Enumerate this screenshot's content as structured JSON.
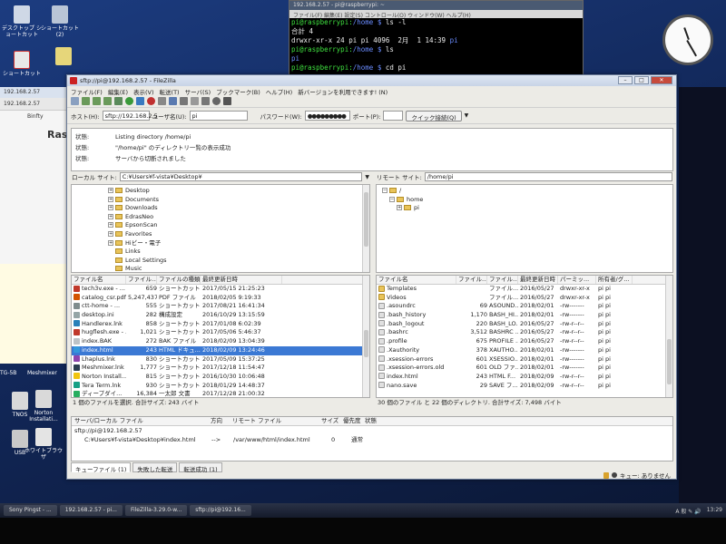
{
  "desktop_icons": [
    {
      "label": "デスクトップ\nショートカット"
    },
    {
      "label": "ショートカット\n(2)"
    },
    {
      "label": "ショートカット"
    },
    {
      "label": "TNOS"
    },
    {
      "label": "Norton\nInstallati..."
    },
    {
      "label": "USB"
    },
    {
      "label": "ホワイトブラウザ"
    }
  ],
  "bg_window": {
    "title": "192.168.2.57",
    "tab": "192.168.2.57",
    "heading": "Rasp",
    "bookmark": "Binfty",
    "side_labels": [
      "TG-5B",
      "Meshmixer"
    ]
  },
  "terminal": {
    "title": "192.168.2.57 - pi@raspberrypi: ~",
    "menu": "ファイル(F)  編集(E)  設定(S)  コントロール(O)  ウィンドウ(W)  ヘルプ(H)",
    "lines": [
      {
        "prompt": "pi@raspberrypi:",
        "path": "/home $",
        "cmd": " ls -l"
      },
      {
        "text": "合計 4"
      },
      {
        "text": "drwxr-xr-x 24 pi pi 4096  2月  1 14:39 ",
        "blue": "pi"
      },
      {
        "prompt": "pi@raspberrypi:",
        "path": "/home $",
        "cmd": " ls"
      },
      {
        "blue": "pi"
      },
      {
        "prompt": "pi@raspberrypi:",
        "path": "/home $",
        "cmd": " cd pi"
      }
    ]
  },
  "filezilla": {
    "title": "sftp://pi@192.168.2.57 - FileZilla",
    "menu": [
      "ファイル(F)",
      "編集(E)",
      "表示(V)",
      "転送(T)",
      "サーバ(S)",
      "ブックマーク(B)",
      "ヘルプ(H)",
      "新バージョンを利用できます! (N)"
    ],
    "quickconnect": {
      "host_label": "ホスト(H):",
      "host_value": "sftp://192.168.2.5",
      "user_label": "ユーザ名(U):",
      "user_value": "pi",
      "pass_label": "パスワード(W):",
      "pass_value": "●●●●●●●●●",
      "port_label": "ポート(P):",
      "port_value": "",
      "button": "クイック接続(Q)"
    },
    "log": [
      {
        "k": "状態:",
        "v": "Listing directory /home/pi"
      },
      {
        "k": "状態:",
        "v": "\"/home/pi\" のディレクトリ一覧の表示成功"
      },
      {
        "k": "状態:",
        "v": "サーバから切断されました"
      }
    ],
    "local": {
      "site_label": "ローカル サイト:",
      "path": "C:¥Users¥f-vista¥Desktop¥",
      "tree": [
        "Desktop",
        "Documents",
        "Downloads",
        "EdrasNeo",
        "EpsonScan",
        "Favorites",
        "Hiビー・電子",
        "Links",
        "Local Settings",
        "Music"
      ],
      "columns": [
        "ファイル名",
        "ファイル...",
        "ファイルの種類",
        "最終更新日時"
      ],
      "files": [
        {
          "name": "tech3v.exe - ...",
          "size": "659",
          "type": "ショートカット",
          "date": "2017/05/15 21:25:23"
        },
        {
          "name": "catalog_csr.pdf",
          "size": "5,247,437",
          "type": "PDF ファイル",
          "date": "2018/02/05 9:19:33"
        },
        {
          "name": "ctt-home - ...",
          "size": "555",
          "type": "ショートカット",
          "date": "2017/08/21 16:41:34"
        },
        {
          "name": "desktop.ini",
          "size": "282",
          "type": "構成設定",
          "date": "2016/10/29 13:15:59"
        },
        {
          "name": "Handlerex.lnk",
          "size": "858",
          "type": "ショートカット",
          "date": "2017/01/08 6:02:39"
        },
        {
          "name": "hugflesh.exe - ...",
          "size": "1,021",
          "type": "ショートカット",
          "date": "2017/05/06 5:46:37"
        },
        {
          "name": "index.BAK",
          "size": "272",
          "type": "BAK ファイル",
          "date": "2018/02/09 13:04:39"
        },
        {
          "name": "index.html",
          "size": "243",
          "type": "HTML ドキュ...",
          "date": "2018/02/09 13:24:46"
        },
        {
          "name": "Lhaplus.lnk",
          "size": "830",
          "type": "ショートカット",
          "date": "2017/05/09 15:37:25"
        },
        {
          "name": "Meshmixer.lnk",
          "size": "1,777",
          "type": "ショートカット",
          "date": "2017/12/18 11:54:47"
        },
        {
          "name": "Norton Install...",
          "size": "815",
          "type": "ショートカット",
          "date": "2016/10/30 10:06:48"
        },
        {
          "name": "Tera Term.lnk",
          "size": "930",
          "type": "ショートカット",
          "date": "2018/01/29 14:48:37"
        },
        {
          "name": "ディープダイ...",
          "size": "16,384",
          "type": "一太郎 文書",
          "date": "2017/12/28 21:00:32"
        }
      ],
      "status": "1 個のファイルを選択. 合計サイズ: 243 バイト"
    },
    "remote": {
      "site_label": "リモート サイト:",
      "path": "/home/pi",
      "tree": [
        "/",
        "home",
        "pi"
      ],
      "columns": [
        "ファイル名",
        "ファイル...",
        "ファイル...",
        "最終更新日時",
        "パーミッ...",
        "所有者/グ..."
      ],
      "files": [
        {
          "name": "Templates",
          "size": "",
          "type": "ファイル...",
          "date": "2016/05/27",
          "perm": "drwxr-xr-x",
          "owner": "pi pi"
        },
        {
          "name": "Videos",
          "size": "",
          "type": "ファイル...",
          "date": "2016/05/27",
          "perm": "drwxr-xr-x",
          "owner": "pi pi"
        },
        {
          "name": ".asoundrc",
          "size": "69",
          "type": "ASOUND...",
          "date": "2018/02/01",
          "perm": "-rw-------",
          "owner": "pi pi"
        },
        {
          "name": ".bash_history",
          "size": "1,170",
          "type": "BASH_HI...",
          "date": "2018/02/01",
          "perm": "-rw-------",
          "owner": "pi pi"
        },
        {
          "name": ".bash_logout",
          "size": "220",
          "type": "BASH_LO...",
          "date": "2016/05/27",
          "perm": "-rw-r--r--",
          "owner": "pi pi"
        },
        {
          "name": ".bashrc",
          "size": "3,512",
          "type": "BASHRC ...",
          "date": "2016/05/27",
          "perm": "-rw-r--r--",
          "owner": "pi pi"
        },
        {
          "name": ".profile",
          "size": "675",
          "type": "PROFILE ...",
          "date": "2016/05/27",
          "perm": "-rw-r--r--",
          "owner": "pi pi"
        },
        {
          "name": ".Xauthority",
          "size": "378",
          "type": "XAUTHO...",
          "date": "2018/02/01",
          "perm": "-rw-------",
          "owner": "pi pi"
        },
        {
          "name": ".xsession-errors",
          "size": "601",
          "type": "XSESSIO...",
          "date": "2018/02/01",
          "perm": "-rw-------",
          "owner": "pi pi"
        },
        {
          "name": ".xsession-errors.old",
          "size": "601",
          "type": "OLD ファ...",
          "date": "2018/02/01",
          "perm": "-rw-------",
          "owner": "pi pi"
        },
        {
          "name": "index.html",
          "size": "243",
          "type": "HTML F...",
          "date": "2018/02/09",
          "perm": "-rw-r--r--",
          "owner": "pi pi"
        },
        {
          "name": "nano.save",
          "size": "29",
          "type": "SAVE フ...",
          "date": "2018/02/09",
          "perm": "-rw-r--r--",
          "owner": "pi pi"
        }
      ],
      "status": "30 個のファイル と 22 個のディレクトリ. 合計サイズ: 7,498 バイト"
    },
    "queue": {
      "columns": [
        "サーバ/ローカル ファイル",
        "方向",
        "リモート ファイル",
        "サイズ",
        "優先度",
        "状態"
      ],
      "server": "sftp://pi@192.168.2.57",
      "local_file": "C:¥Users¥f-vista¥Desktop¥index.html",
      "dir": "-->",
      "remote_file": "/var/www/html/index.html",
      "size": "0",
      "priority": "通常",
      "status": ""
    },
    "tabs": [
      "キューファイル (1)",
      "失敗した転送",
      "転送成功 (1)"
    ],
    "status_text": "キュー: ありません"
  },
  "taskbar": {
    "tasks": [
      "Sony Pingst - ...",
      "192.168.2.57 - pi...",
      "FileZilla-3.29.0-w...",
      "sftp://pi@192.16..."
    ],
    "tray": "A  般  ✎  🔊",
    "time": "13:29"
  },
  "colors": {
    "selection": "#3b79d4",
    "terminal_green": "#3fe03f",
    "terminal_blue": "#6a8cff"
  }
}
